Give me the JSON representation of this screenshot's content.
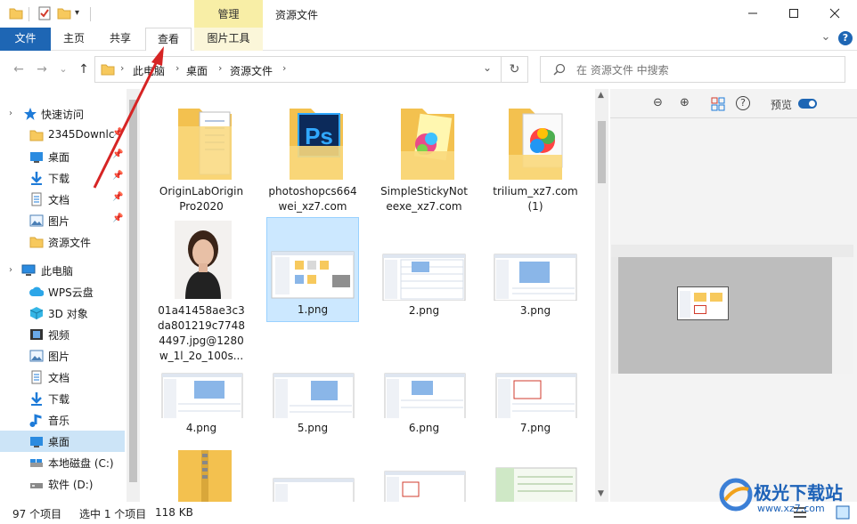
{
  "titlebar": {
    "context_tab": "管理",
    "window_title": "资源文件",
    "minimize": "—",
    "maximize": "☐",
    "close": "✕"
  },
  "ribbon": {
    "tabs": [
      {
        "label": "文件"
      },
      {
        "label": "主页"
      },
      {
        "label": "共享"
      },
      {
        "label": "查看"
      },
      {
        "label": "图片工具"
      }
    ],
    "expand": "⌄",
    "help": "?"
  },
  "nav": {
    "back": "←",
    "forward": "→",
    "recent": "⌄",
    "up": "↑",
    "breadcrumb": [
      "此电脑",
      "桌面",
      "资源文件"
    ],
    "dropdown": "⌄",
    "refresh": "↻",
    "search_placeholder": "在 资源文件 中搜索"
  },
  "sidebar": {
    "items": [
      {
        "label": "快速访问",
        "icon": "star-icon",
        "pinned": false
      },
      {
        "label": "2345Downlc",
        "icon": "folder-icon",
        "pinned": true
      },
      {
        "label": "桌面",
        "icon": "desktop-icon",
        "pinned": true
      },
      {
        "label": "下载",
        "icon": "download-icon",
        "pinned": true
      },
      {
        "label": "文档",
        "icon": "document-icon",
        "pinned": true
      },
      {
        "label": "图片",
        "icon": "picture-icon",
        "pinned": true
      },
      {
        "label": "资源文件",
        "icon": "folder-icon",
        "pinned": false
      },
      {
        "label": "此电脑",
        "icon": "computer-icon",
        "pinned": false
      },
      {
        "label": "WPS云盘",
        "icon": "cloud-icon",
        "pinned": false
      },
      {
        "label": "3D 对象",
        "icon": "cube-icon",
        "pinned": false
      },
      {
        "label": "视频",
        "icon": "video-icon",
        "pinned": false
      },
      {
        "label": "图片",
        "icon": "picture-icon",
        "pinned": false
      },
      {
        "label": "文档",
        "icon": "document-icon",
        "pinned": false
      },
      {
        "label": "下载",
        "icon": "download-icon",
        "pinned": false
      },
      {
        "label": "音乐",
        "icon": "music-icon",
        "pinned": false
      },
      {
        "label": "桌面",
        "icon": "desktop-icon",
        "pinned": false,
        "selected": true
      },
      {
        "label": "本地磁盘 (C:)",
        "icon": "drive-icon",
        "pinned": false
      },
      {
        "label": "软件 (D:)",
        "icon": "drive-icon",
        "pinned": false
      }
    ]
  },
  "files": [
    {
      "name": "OriginLabOriginPro2020",
      "kind": "folder-doc"
    },
    {
      "name": "photoshopcs664wei_xz7.com",
      "kind": "folder-ps"
    },
    {
      "name": "SimpleStickyNoteexe_xz7.com",
      "kind": "folder-color"
    },
    {
      "name": "trilium_xz7.com (1)",
      "kind": "folder-color-paper"
    },
    {
      "name": "01a41458ae3c3da801219c77484497.jpg@1280w_1l_2o_100s...",
      "kind": "photo"
    },
    {
      "name": "1.png",
      "kind": "screenshot",
      "selected": true
    },
    {
      "name": "2.png",
      "kind": "screenshot"
    },
    {
      "name": "3.png",
      "kind": "screenshot"
    },
    {
      "name": "4.png",
      "kind": "screenshot"
    },
    {
      "name": "5.png",
      "kind": "screenshot"
    },
    {
      "name": "6.png",
      "kind": "screenshot"
    },
    {
      "name": "7.png",
      "kind": "screenshot"
    },
    {
      "name": "",
      "kind": "zip"
    },
    {
      "name": "",
      "kind": "screenshot"
    },
    {
      "name": "",
      "kind": "screenshot"
    },
    {
      "name": "",
      "kind": "screenshot-green"
    }
  ],
  "preview": {
    "zoom_out": "⊖",
    "zoom_in": "⊕",
    "help": "?",
    "label": "预览"
  },
  "status": {
    "count": "97 个项目",
    "selection": "选中 1 个项目",
    "size": "118 KB"
  },
  "watermark": {
    "brand": "极光下载站",
    "url": "www.xz7.com"
  },
  "colors": {
    "accent": "#1e66b4",
    "selection": "#cce8ff",
    "folder": "#f7c95d",
    "annotation_arrow": "#d62424"
  }
}
